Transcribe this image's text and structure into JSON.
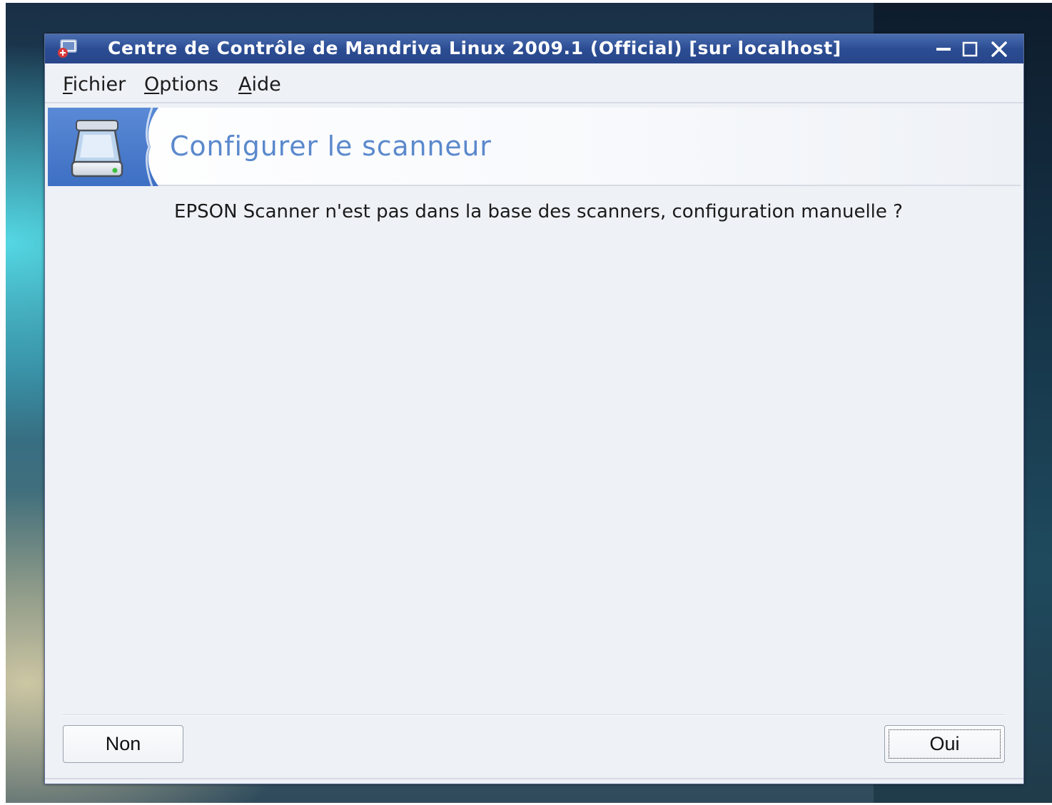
{
  "window": {
    "title": "Centre de Contrôle de Mandriva Linux 2009.1 (Official) [sur localhost]"
  },
  "menu": {
    "fichier": {
      "first": "F",
      "rest": "ichier"
    },
    "options": {
      "first": "O",
      "rest": "ptions"
    },
    "aide": {
      "first": "A",
      "rest": "ide"
    }
  },
  "banner": {
    "title": "Configurer le scanneur",
    "icon": "scanner-icon"
  },
  "dialog": {
    "message": "EPSON Scanner n'est pas dans la base des scanners, configuration manuelle ?"
  },
  "buttons": {
    "non": "Non",
    "oui": "Oui"
  },
  "colors": {
    "titlebar": "#2c4d93",
    "banner_accent": "#4a7bd0",
    "banner_title": "#5b89cc",
    "window_bg": "#eef1f6"
  }
}
